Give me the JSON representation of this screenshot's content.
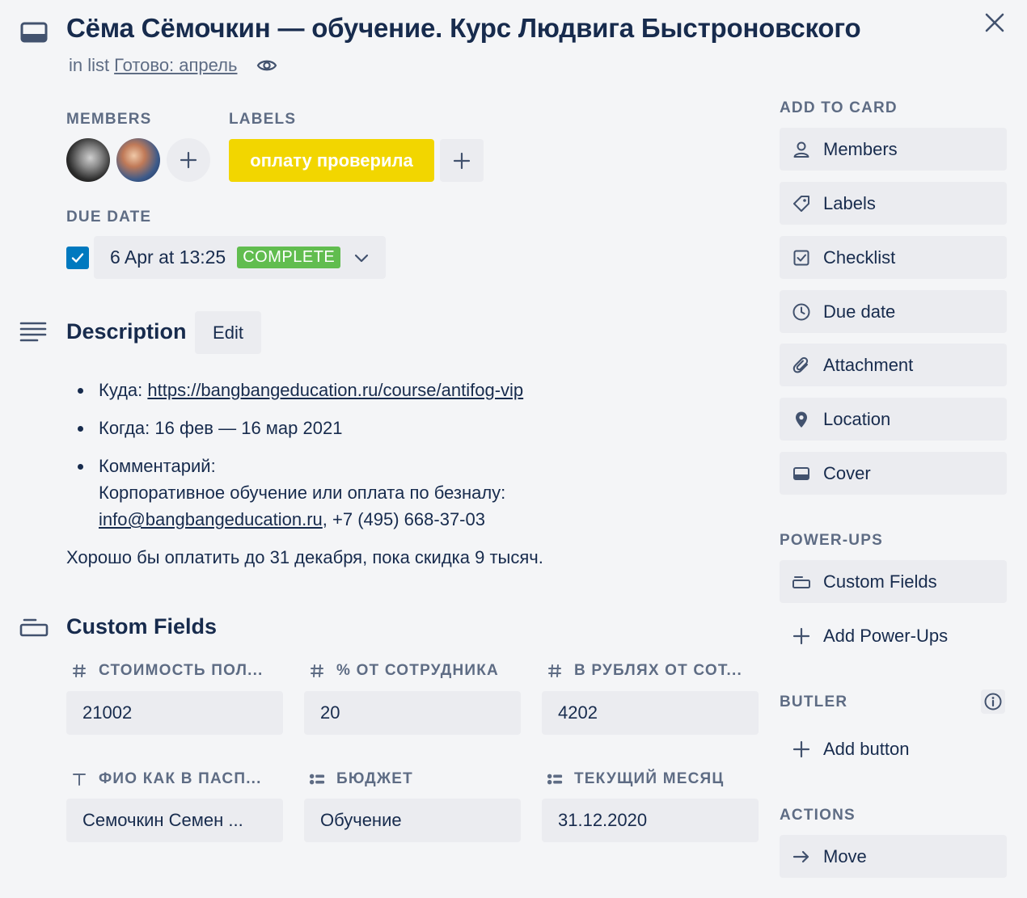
{
  "card": {
    "title": "Сёма Сёмочкин — обучение. Курс Людвига Быстроновского",
    "in_list_prefix": "in list",
    "list_name": "Готово: апрель"
  },
  "members": {
    "heading": "MEMBERS"
  },
  "labels": {
    "heading": "LABELS",
    "items": [
      {
        "text": "оплату проверила",
        "color": "#f2d600"
      }
    ]
  },
  "due_date": {
    "heading": "DUE DATE",
    "checked": true,
    "value": "6 Apr at 13:25",
    "status": "COMPLETE",
    "status_color": "#61bd4f"
  },
  "description": {
    "heading": "Description",
    "edit_label": "Edit",
    "items": [
      {
        "prefix": "Куда: ",
        "link": "https://bangbangeducation.ru/course/antifog-vip"
      },
      {
        "text": "Когда: 16 фев — 16 мар 2021"
      },
      {
        "line1": "Комментарий:",
        "line2": "Корпоративное обучение или оплата по безналу:",
        "email": "info@bangbangeducation.ru",
        "phone": ", +7 (495) 668-37-03"
      }
    ],
    "footer": "Хорошо бы оплатить до 31 декабря, пока скидка 9 тысяч."
  },
  "custom_fields": {
    "heading": "Custom Fields",
    "fields": [
      {
        "label": "СТОИМОСТЬ ПОЛ...",
        "icon": "number-icon",
        "value": "21002"
      },
      {
        "label": "% ОТ СОТРУДНИКА",
        "icon": "number-icon",
        "value": "20"
      },
      {
        "label": "В РУБЛЯХ ОТ СОТ...",
        "icon": "number-icon",
        "value": "4202"
      },
      {
        "label": "ФИО КАК В ПАСП...",
        "icon": "text-icon",
        "value": "Семочкин Семен ..."
      },
      {
        "label": "БЮДЖЕТ",
        "icon": "list-icon",
        "value": "Обучение"
      },
      {
        "label": "ТЕКУЩИЙ МЕСЯЦ",
        "icon": "list-icon",
        "value": "31.12.2020"
      }
    ]
  },
  "sidebar": {
    "add_to_card_heading": "ADD TO CARD",
    "add_to_card": [
      {
        "label": "Members",
        "icon": "person-icon"
      },
      {
        "label": "Labels",
        "icon": "tag-icon"
      },
      {
        "label": "Checklist",
        "icon": "checklist-icon"
      },
      {
        "label": "Due date",
        "icon": "clock-icon"
      },
      {
        "label": "Attachment",
        "icon": "paperclip-icon"
      },
      {
        "label": "Location",
        "icon": "pin-icon"
      },
      {
        "label": "Cover",
        "icon": "cover-icon"
      }
    ],
    "power_ups_heading": "POWER-UPS",
    "custom_fields_btn": "Custom Fields",
    "add_power_ups": "Add Power-Ups",
    "butler_heading": "BUTLER",
    "add_button": "Add button",
    "actions_heading": "ACTIONS",
    "move": "Move"
  }
}
